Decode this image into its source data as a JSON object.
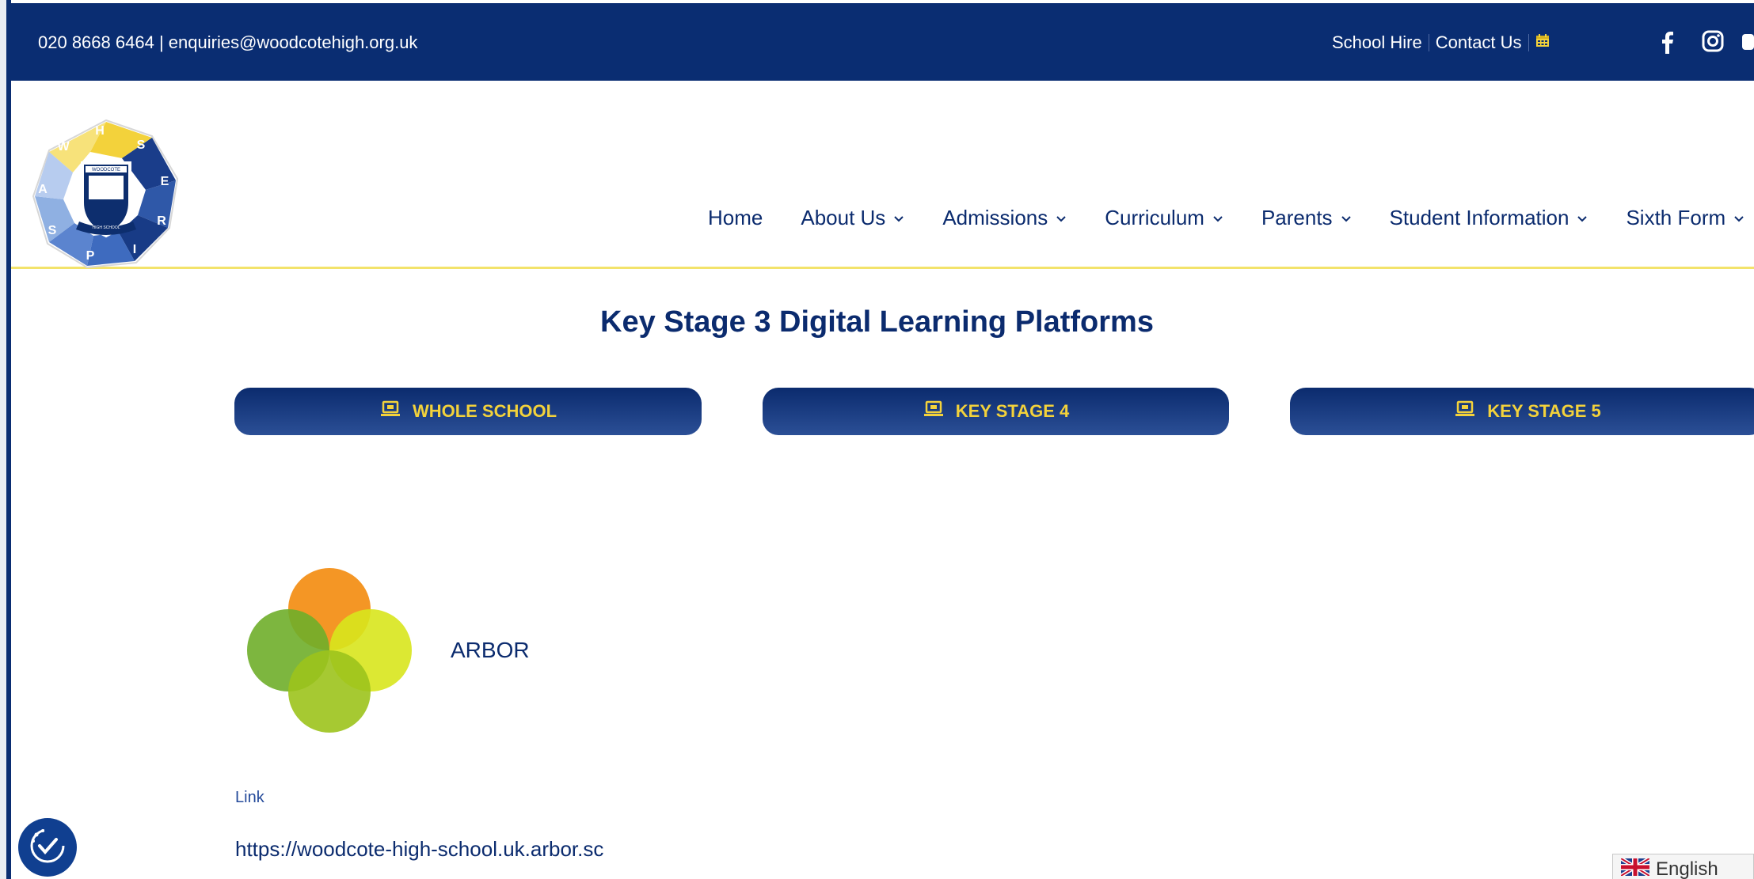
{
  "topbar": {
    "phone": "020 8668 6464",
    "separator": "|",
    "email": "enquiries@woodcotehigh.org.uk",
    "links": [
      "School Hire",
      "Contact Us"
    ],
    "icons": [
      "calendar-icon",
      "facebook-icon",
      "instagram-icon",
      "youtube-icon"
    ],
    "accent": "#f3d23b",
    "background": "#0a2d72"
  },
  "logo": {
    "letters": [
      "W",
      "H",
      "S",
      "E",
      "R",
      "I",
      "P",
      "S",
      "A"
    ],
    "crest_text": "WOODCOTE",
    "crest_sub": "HIGH SCHOOL"
  },
  "nav": {
    "items": [
      {
        "label": "Home",
        "dropdown": false
      },
      {
        "label": "About Us",
        "dropdown": true
      },
      {
        "label": "Admissions",
        "dropdown": true
      },
      {
        "label": "Curriculum",
        "dropdown": true
      },
      {
        "label": "Parents",
        "dropdown": true
      },
      {
        "label": "Student Information",
        "dropdown": true
      },
      {
        "label": "Sixth Form",
        "dropdown": true
      }
    ]
  },
  "main": {
    "title": "Key Stage 3 Digital Learning Platforms",
    "buttons": [
      {
        "label": "WHOLE SCHOOL"
      },
      {
        "label": "KEY STAGE 4"
      },
      {
        "label": "KEY STAGE 5"
      }
    ],
    "platform": {
      "name": "ARBOR",
      "link_label": "Link",
      "url": "https://woodcote-high-school.uk.arbor.sc"
    }
  },
  "footer": {
    "language": "English"
  }
}
